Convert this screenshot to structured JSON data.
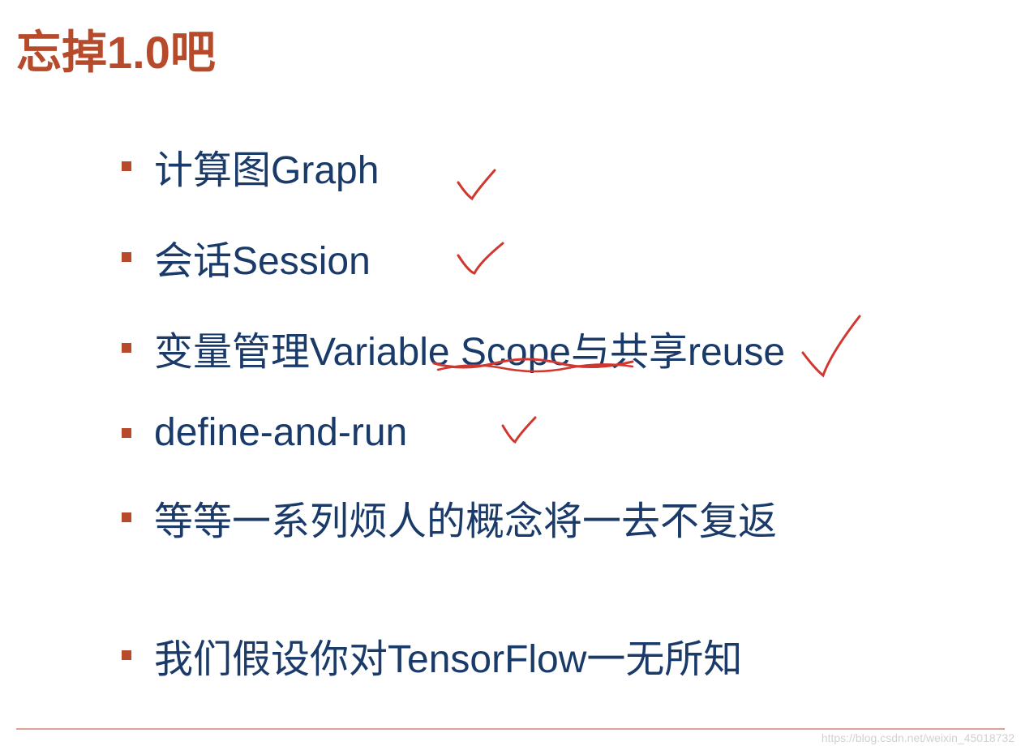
{
  "slide": {
    "title": "忘掉1.0吧",
    "bullets": [
      {
        "text": "计算图Graph"
      },
      {
        "text": "会话Session"
      },
      {
        "text": "变量管理Variable Scope与共享reuse"
      },
      {
        "text": "define-and-run"
      },
      {
        "text": "等等一系列烦人的概念将一去不复返"
      },
      {
        "text": "我们假设你对TensorFlow一无所知"
      }
    ]
  },
  "watermark": "https://blog.csdn.net/weixin_45018732",
  "colors": {
    "title": "#b74a2a",
    "body": "#1a3a6a",
    "annotation": "#d1362f"
  }
}
